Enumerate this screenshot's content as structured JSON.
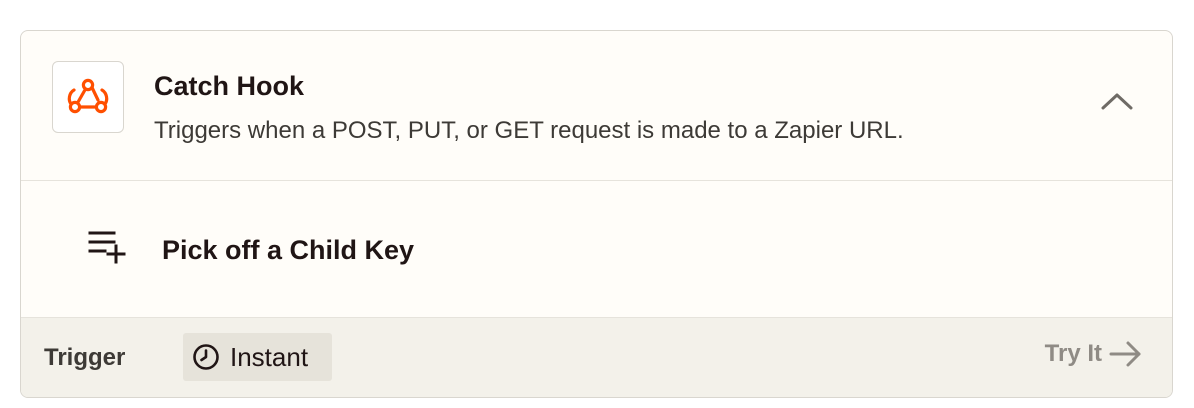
{
  "trigger_card": {
    "app_icon": "webhook-icon",
    "title": "Catch Hook",
    "description": "Triggers when a POST, PUT, or GET request is made to a Zapier URL.",
    "collapse_icon": "chevron-up-icon"
  },
  "options": [
    {
      "icon": "playlist-add-icon",
      "label": "Pick off a Child Key"
    }
  ],
  "footer": {
    "type_label": "Trigger",
    "badge_icon": "clock-icon",
    "badge_label": "Instant",
    "try_label": "Try It",
    "try_icon": "arrow-right-icon"
  },
  "colors": {
    "brand_orange": "#ff4f00",
    "card_background": "#fffdf9",
    "footer_background": "#f3f1ea",
    "badge_background": "#e6e3da",
    "muted_text": "#8f8b85"
  }
}
